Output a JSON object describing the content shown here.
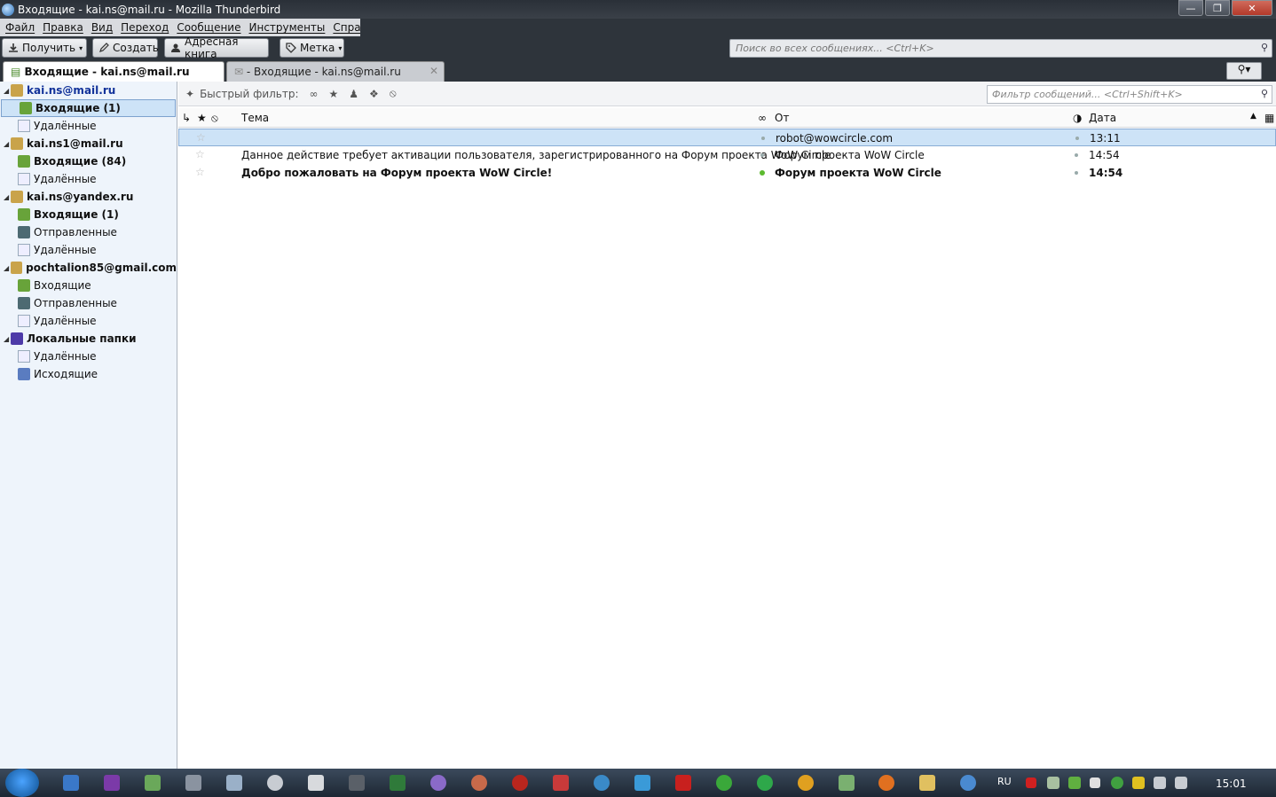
{
  "window": {
    "title": "Входящие - kai.ns@mail.ru - Mozilla Thunderbird"
  },
  "menu": [
    "Файл",
    "Правка",
    "Вид",
    "Переход",
    "Сообщение",
    "Инструменты",
    "Справка"
  ],
  "toolbar": {
    "get_label": "Получить",
    "write_label": "Создать",
    "address_book_label": "Адресная книга",
    "tag_label": "Метка",
    "search_placeholder": "Поиск во всех сообщениях... <Ctrl+K>"
  },
  "tabs": [
    {
      "label": "Входящие - kai.ns@mail.ru"
    },
    {
      "label": "- Входящие - kai.ns@mail.ru"
    }
  ],
  "folders": {
    "accounts": [
      {
        "name": "kai.ns@mail.ru",
        "folders": [
          {
            "name": "Входящие (1)"
          },
          {
            "name": "Удалённые"
          }
        ]
      },
      {
        "name": "kai.ns1@mail.ru",
        "folders": [
          {
            "name": "Входящие (84)"
          },
          {
            "name": "Удалённые"
          }
        ]
      },
      {
        "name": "kai.ns@yandex.ru",
        "folders": [
          {
            "name": "Входящие (1)"
          },
          {
            "name": "Отправленные"
          },
          {
            "name": "Удалённые"
          }
        ]
      },
      {
        "name": "pochtalion85@gmail.com",
        "folders": [
          {
            "name": "Входящие"
          },
          {
            "name": "Отправленные"
          },
          {
            "name": "Удалённые"
          }
        ]
      },
      {
        "name": "Локальные папки",
        "folders": [
          {
            "name": "Удалённые"
          },
          {
            "name": "Исходящие"
          }
        ]
      }
    ]
  },
  "quickfilter": {
    "label": "Быстрый фильтр:",
    "placeholder": "Фильтр сообщений... <Ctrl+Shift+K>"
  },
  "columns": {
    "subject": "Тема",
    "from": "От",
    "date": "Дата"
  },
  "messages": [
    {
      "subject": "",
      "from": "robot@wowcircle.com",
      "date": "13:11"
    },
    {
      "subject": "Данное действие требует активации пользователя, зарегистрированного на Форум проекта WoW Circle",
      "from": "Форум проекта WoW Circle",
      "date": "14:54"
    },
    {
      "subject": "Добро пожаловать на Форум проекта WoW Circle!",
      "from": "Форум проекта WoW Circle",
      "date": "14:54"
    }
  ],
  "taskbar": {
    "lang": "RU",
    "clock": "15:01"
  }
}
